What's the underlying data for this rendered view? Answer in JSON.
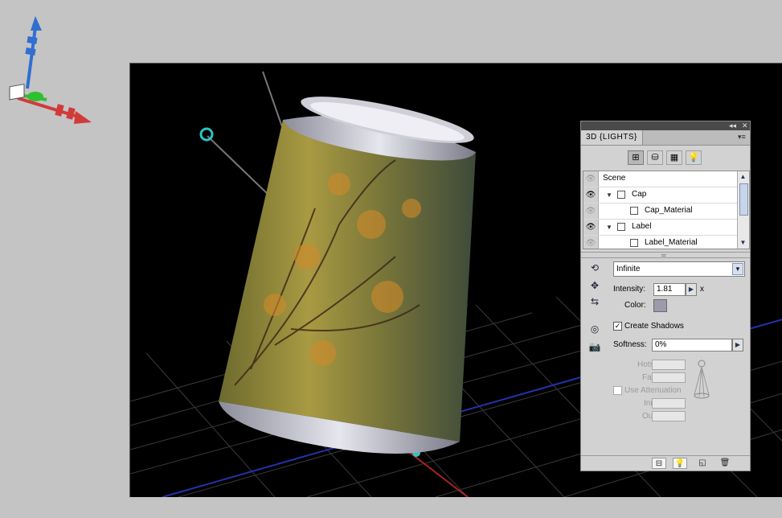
{
  "panel": {
    "title": "3D {LIGHTS}",
    "collapse_label": "◂◂",
    "close_label": "✕",
    "menu_label": "▾≡"
  },
  "filter_buttons": [
    {
      "name": "whole-scene-filter",
      "glyph": "⊞",
      "active": true
    },
    {
      "name": "meshes-filter",
      "glyph": "⛁",
      "active": false
    },
    {
      "name": "materials-filter",
      "glyph": "▦",
      "active": false
    },
    {
      "name": "lights-filter",
      "glyph": "💡",
      "active": false
    }
  ],
  "scene_tree": [
    {
      "label": "Scene",
      "visible": false,
      "indent": 0,
      "expandable": false,
      "icon": "none"
    },
    {
      "label": "Cap",
      "visible": true,
      "indent": 1,
      "expandable": true,
      "icon": "mesh"
    },
    {
      "label": "Cap_Material",
      "visible": false,
      "indent": 2,
      "expandable": false,
      "icon": "material"
    },
    {
      "label": "Label",
      "visible": true,
      "indent": 1,
      "expandable": true,
      "icon": "mesh"
    },
    {
      "label": "Label_Material",
      "visible": false,
      "indent": 2,
      "expandable": false,
      "icon": "material"
    }
  ],
  "light": {
    "type": "Infinite",
    "intensity_label": "Intensity:",
    "intensity": "1.81",
    "intensity_suffix": "x",
    "color_label": "Color:",
    "color": "#9b9bab",
    "create_shadows_label": "Create Shadows",
    "create_shadows": true,
    "softness_label": "Softness:",
    "softness": "0%",
    "hotspot_label": "Hotspot:",
    "falloff_label": "Falloff:",
    "use_attenuation_label": "Use Attenuation",
    "use_attenuation": false,
    "inner_label": "Inner:",
    "outer_label": "Outer:"
  },
  "colors": {
    "canvas_bg": "#000000",
    "workspace_bg": "#c4c4c4",
    "panel_bg": "#d2d2d2",
    "axis_x": "#d23a3a",
    "axis_y": "#2f6fd0",
    "axis_z": "#2fbf2f",
    "light_handle": "#2ec4c4"
  }
}
